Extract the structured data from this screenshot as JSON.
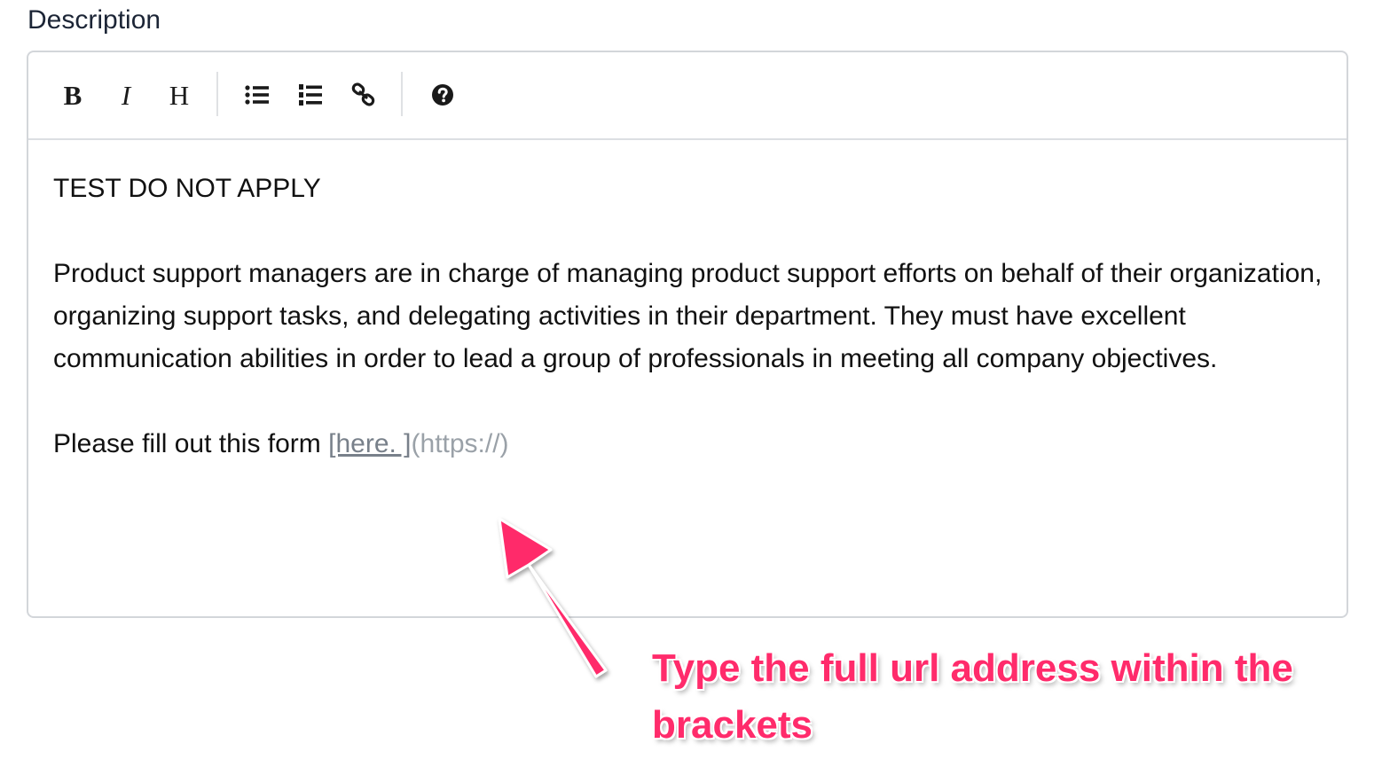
{
  "field": {
    "label": "Description"
  },
  "toolbar": {
    "bold_label": "B",
    "italic_label": "I",
    "heading_label": "H",
    "icons": [
      "bullet-list-icon",
      "numbered-list-icon",
      "link-icon",
      "help-icon"
    ]
  },
  "editor": {
    "line1": "TEST DO NOT APPLY",
    "paragraph": "Product support managers are in charge of managing product support efforts on behalf of their organization, organizing support tasks, and delegating activities in their department. They must have excellent communication abilities in order to lead a group of professionals in meeting all company objectives.",
    "form_prefix": "Please fill out this form ",
    "link_text": "[here. ]",
    "link_url": "(https://)"
  },
  "annotation": {
    "text": "Type the full url address within the brackets",
    "color": "#ff2b6b"
  }
}
